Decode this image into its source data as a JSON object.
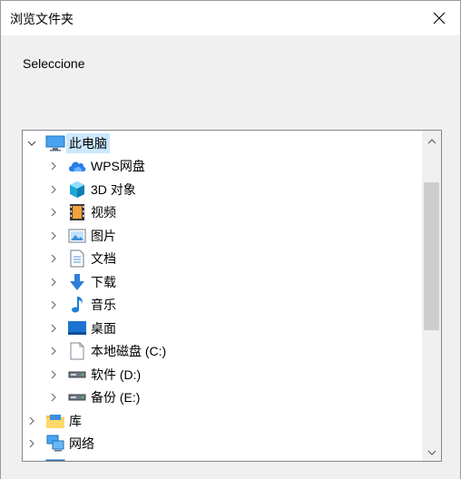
{
  "window": {
    "title": "浏览文件夹",
    "prompt": "Seleccione"
  },
  "tree": {
    "items": [
      {
        "label": "此电脑",
        "icon": "computer-icon",
        "level": 0,
        "expanded": true,
        "selected": true
      },
      {
        "label": "WPS网盘",
        "icon": "cloud-drive-icon",
        "level": 1
      },
      {
        "label": "3D 对象",
        "icon": "3d-objects-icon",
        "level": 1
      },
      {
        "label": "视频",
        "icon": "video-folder-icon",
        "level": 1
      },
      {
        "label": "图片",
        "icon": "pictures-folder-icon",
        "level": 1
      },
      {
        "label": "文档",
        "icon": "documents-folder-icon",
        "level": 1
      },
      {
        "label": "下载",
        "icon": "download-icon",
        "level": 1
      },
      {
        "label": "音乐",
        "icon": "music-icon",
        "level": 1
      },
      {
        "label": "桌面",
        "icon": "desktop-icon",
        "level": 1
      },
      {
        "label": "本地磁盘 (C:)",
        "icon": "drive-c-icon",
        "level": 1
      },
      {
        "label": "软件 (D:)",
        "icon": "drive-icon",
        "level": 1
      },
      {
        "label": "备份 (E:)",
        "icon": "drive-icon",
        "level": 1
      },
      {
        "label": "库",
        "icon": "library-icon",
        "level": 0
      },
      {
        "label": "网络",
        "icon": "network-icon",
        "level": 0
      },
      {
        "label": "控制面板",
        "icon": "control-panel-icon",
        "level": 0
      }
    ]
  },
  "colors": {
    "selection": "#cce8ff",
    "accent_blue": "#1e88e5"
  }
}
